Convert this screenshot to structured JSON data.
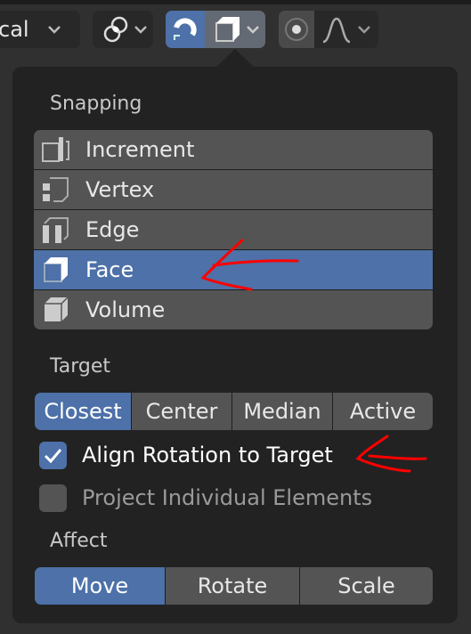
{
  "toolbar": {
    "orientation_value": "cal",
    "pivot_icon": "pivot-icon",
    "snap_active": true,
    "snap_target_icon": "face-snap-icon",
    "proportional_active": false,
    "falloff_icon": "falloff-icon"
  },
  "popover": {
    "snapping_label": "Snapping",
    "snap_items": [
      {
        "label": "Increment",
        "icon": "increment-icon"
      },
      {
        "label": "Vertex",
        "icon": "vertex-icon"
      },
      {
        "label": "Edge",
        "icon": "edge-icon"
      },
      {
        "label": "Face",
        "icon": "face-icon",
        "selected": true
      },
      {
        "label": "Volume",
        "icon": "volume-icon"
      }
    ],
    "target_label": "Target",
    "target_options": [
      "Closest",
      "Center",
      "Median",
      "Active"
    ],
    "target_selected": "Closest",
    "align_rotation": {
      "label": "Align Rotation to Target",
      "checked": true
    },
    "project_individual": {
      "label": "Project Individual Elements",
      "checked": false
    },
    "affect_label": "Affect",
    "affect_options": [
      "Move",
      "Rotate",
      "Scale"
    ],
    "affect_selected": "Move"
  },
  "colors": {
    "accent": "#4d71a8",
    "annotation": "#ff0000"
  }
}
